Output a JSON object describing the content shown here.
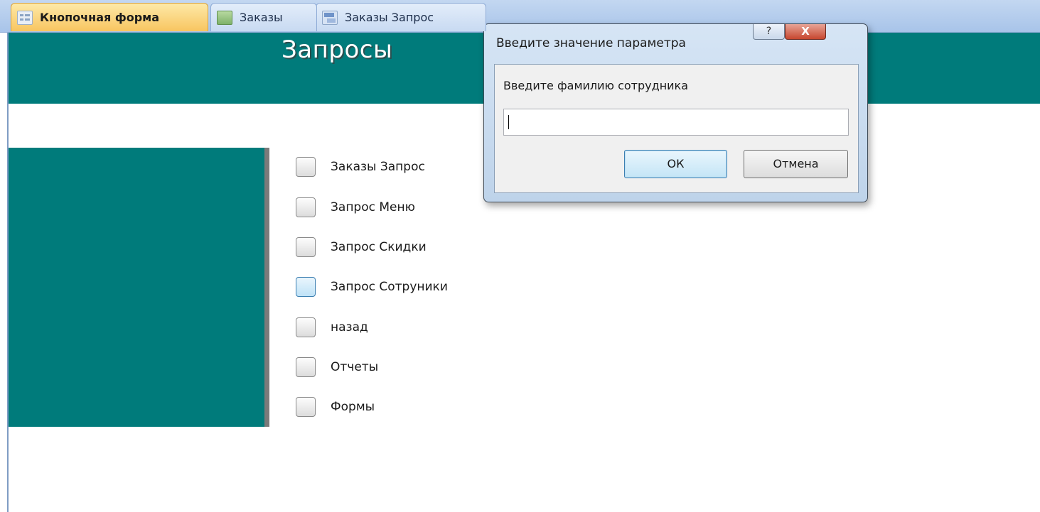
{
  "tabs": [
    {
      "label": "Кнопочная форма",
      "icon": "form-icon",
      "active": true
    },
    {
      "label": "Заказы",
      "icon": "table-icon",
      "active": false
    },
    {
      "label": "Заказы Запрос",
      "icon": "query-icon",
      "active": false
    }
  ],
  "form": {
    "title": "Запросы",
    "items": [
      {
        "label": "Заказы Запрос"
      },
      {
        "label": "Запрос Меню"
      },
      {
        "label": "Запрос Скидки"
      },
      {
        "label": "Запрос Сотруники"
      },
      {
        "label": "назад"
      },
      {
        "label": "Отчеты"
      },
      {
        "label": "Формы"
      }
    ]
  },
  "dialog": {
    "title": "Введите значение параметра",
    "help_label": "?",
    "close_label": "X",
    "prompt": "Введите фамилию сотрудника",
    "input_value": "",
    "ok_label": "ОК",
    "cancel_label": "Отмена"
  },
  "colors": {
    "teal": "#007b7b",
    "active_tab": "#f8c560",
    "tabstrip": "#a8c4e9"
  }
}
